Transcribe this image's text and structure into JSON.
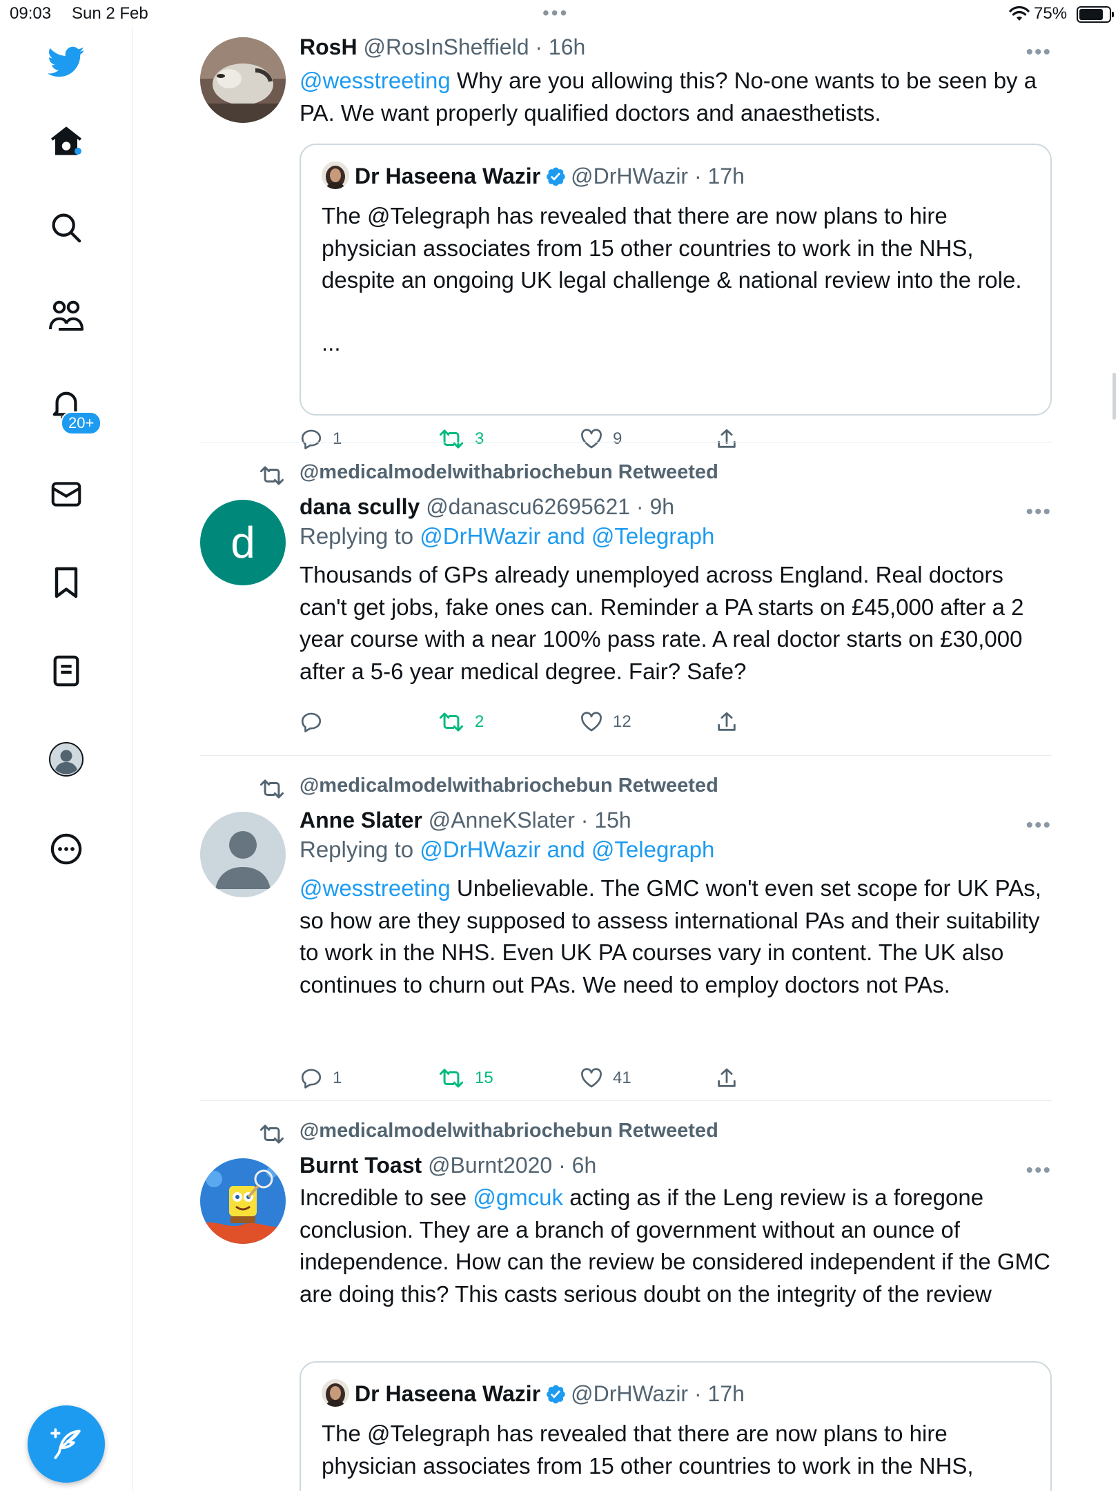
{
  "status_bar": {
    "time": "09:03",
    "date": "Sun 2 Feb",
    "battery": "75%",
    "multitask": "•••"
  },
  "sidebar": {
    "notifications_badge": "20+"
  },
  "tweets": [
    {
      "name": "RosH",
      "handle": "@RosInSheffield · 16h",
      "mention": "@wesstreeting",
      "text": " Why are you allowing this? No-one wants to be seen by a PA. We want properly qualified doctors and anaesthetists.",
      "quote": {
        "name": "Dr Haseena Wazir",
        "handle": "@DrHWazir · 17h",
        "text": "The @Telegraph has revealed that there are now plans to hire physician associates from 15 other countries to work in the NHS, despite an ongoing UK legal challenge & national review into the role.",
        "ellipsis": "..."
      },
      "replies": "1",
      "retweets": "3",
      "likes": "9"
    },
    {
      "retweeted_by": "@medicalmodelwithabriochebun Retweeted",
      "avatar_letter": "d",
      "name": "dana scully",
      "handle": "@danascu62695621 · 9h",
      "replying_label": "Replying to ",
      "replying_to": "@DrHWazir and @Telegraph",
      "text": "Thousands of GPs already unemployed across England. Real doctors can't get jobs, fake ones can. Reminder a PA starts on £45,000 after a 2 year course with a near 100% pass rate. A real doctor starts on £30,000 after a 5-6 year medical degree. Fair? Safe?",
      "replies": "",
      "retweets": "2",
      "likes": "12"
    },
    {
      "retweeted_by": "@medicalmodelwithabriochebun Retweeted",
      "name": "Anne Slater",
      "handle": "@AnneKSlater · 15h",
      "replying_label": "Replying to ",
      "replying_to": "@DrHWazir and @Telegraph",
      "mention": "@wesstreeting",
      "text": " Unbelievable. The GMC won't even set scope for UK PAs, so how are they supposed to assess international PAs and their suitability to work in the NHS. Even UK PA courses vary in content. The UK also continues to churn out PAs. We need to employ doctors not PAs.",
      "replies": "1",
      "retweets": "15",
      "likes": "41"
    },
    {
      "retweeted_by": "@medicalmodelwithabriochebun Retweeted",
      "name": "Burnt Toast",
      "handle": "@Burnt2020 · 6h",
      "text_before": "Incredible to see ",
      "mention": "@gmcuk",
      "text_after": " acting as if the Leng review is a foregone conclusion. They are a branch of government without an ounce of independence. How can the review be considered independent if the GMC are doing this? This casts serious doubt on the integrity of the review",
      "quote": {
        "name": "Dr Haseena Wazir",
        "handle": "@DrHWazir · 17h",
        "text": "The @Telegraph has revealed that there are now plans to hire physician associates from 15 other countries to work in the NHS,"
      }
    }
  ],
  "colors": {
    "accent": "#1d9bf0",
    "retweet": "#00ba7c",
    "muted": "#536471",
    "border": "#cfd9de"
  }
}
